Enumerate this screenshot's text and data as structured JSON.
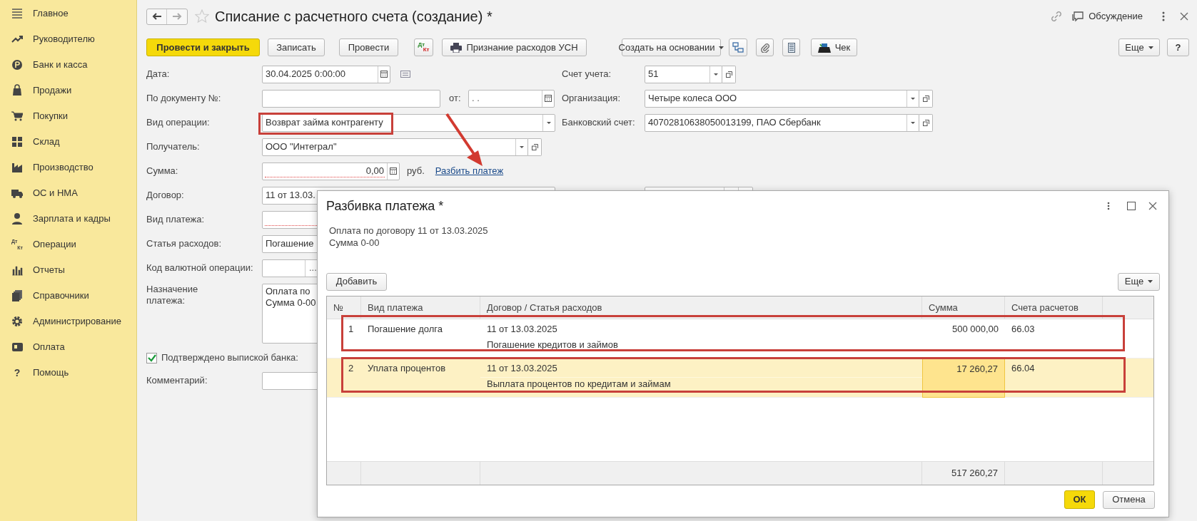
{
  "sidebar": {
    "items": [
      {
        "label": "Главное"
      },
      {
        "label": "Руководителю"
      },
      {
        "label": "Банк и касса"
      },
      {
        "label": "Продажи"
      },
      {
        "label": "Покупки"
      },
      {
        "label": "Склад"
      },
      {
        "label": "Производство"
      },
      {
        "label": "ОС и НМА"
      },
      {
        "label": "Зарплата и кадры"
      },
      {
        "label": "Операции",
        "icon_text": [
          "Дт",
          "Кт"
        ]
      },
      {
        "label": "Отчеты"
      },
      {
        "label": "Справочники"
      },
      {
        "label": "Администрирование"
      },
      {
        "label": "Оплата"
      },
      {
        "label": "Помощь",
        "icon_text": [
          "?"
        ]
      }
    ]
  },
  "window": {
    "title": "Списание с расчетного счета (создание) *",
    "discussion": "Обсуждение"
  },
  "toolbar": {
    "buttons": [
      {
        "kind": "primary",
        "label": "Провести и закрыть"
      },
      {
        "kind": "plain",
        "label": "Записать"
      },
      {
        "kind": "plain",
        "label": "Провести"
      },
      {
        "kind": "dtkt",
        "icon_text": [
          "Дт",
          "Кт"
        ]
      },
      {
        "kind": "printer",
        "label": "Признание расходов УСН"
      },
      {
        "kind": "dropdown",
        "label": "Создать на основании"
      },
      {
        "kind": "structure"
      },
      {
        "kind": "clip"
      },
      {
        "kind": "list"
      },
      {
        "kind": "receipt",
        "label": "Чек"
      }
    ],
    "more": "Еще",
    "help": "?"
  },
  "form": {
    "rows": [
      {
        "kind": "date",
        "label": "Дата:",
        "value": "30.04.2025  0:00:00"
      },
      {
        "kind": "number_date",
        "label": "По документу №:",
        "from_label": "от:",
        "from_date": ".  ."
      },
      {
        "kind": "select",
        "label": "Вид операции:",
        "value": "Возврат займа контрагенту"
      },
      {
        "kind": "select_open",
        "label": "Получатель:",
        "value": "ООО \"Интеграл\""
      },
      {
        "kind": "amount",
        "label": "Сумма:",
        "value": "0,00",
        "currency": "руб.",
        "link": "Разбить платеж",
        "required": true
      },
      {
        "kind": "field",
        "label": "Договор:",
        "value": "11 от 13.03."
      },
      {
        "kind": "field",
        "label": "Вид платежа:",
        "required": true
      },
      {
        "kind": "field",
        "label": "Статья расходов:",
        "value": "Погашение"
      },
      {
        "kind": "picker",
        "label": "Код валютной операции:",
        "button": "..."
      },
      {
        "kind": "textarea",
        "label": "Назначение платежа:",
        "lines": [
          "Оплата по",
          "Сумма 0-00"
        ]
      },
      {
        "kind": "checkbox",
        "label": "Подтверждено выпиской банка:",
        "checked": true
      },
      {
        "kind": "field",
        "label": "Комментарий:"
      }
    ],
    "right": [
      {
        "label": "Счет учета:",
        "value": "51"
      },
      {
        "label": "Организация:",
        "value": "Четыре колеса ООО"
      },
      {
        "label": "Банковский счет:",
        "value": "40702810638050013199, ПАО Сбербанк"
      }
    ]
  },
  "dialog": {
    "title": "Разбивка платежа *",
    "info": [
      "Оплата по договору 11 от 13.03.2025",
      "Сумма 0-00"
    ],
    "add_button": "Добавить",
    "more_button": "Еще",
    "table": {
      "columns": [
        "№",
        "Вид платежа",
        "Договор / Статья расходов",
        "Сумма",
        "Счета расчетов"
      ],
      "rows": [
        {
          "number": "1",
          "payment_type": "Погашение долга",
          "contract": "11 от 13.03.2025",
          "expense_item": "Погашение кредитов и займов",
          "amount": "500 000,00",
          "account": "66.03",
          "selected": false,
          "amount_focused": false
        },
        {
          "number": "2",
          "payment_type": "Уплата процентов",
          "contract": "11 от 13.03.2025",
          "expense_item": "Выплата процентов по кредитам и займам",
          "amount": "17 260,27",
          "account": "66.04",
          "selected": true,
          "amount_focused": true
        }
      ],
      "total": "517 260,27"
    },
    "ok_button": "ОК",
    "cancel_button": "Отмена"
  }
}
